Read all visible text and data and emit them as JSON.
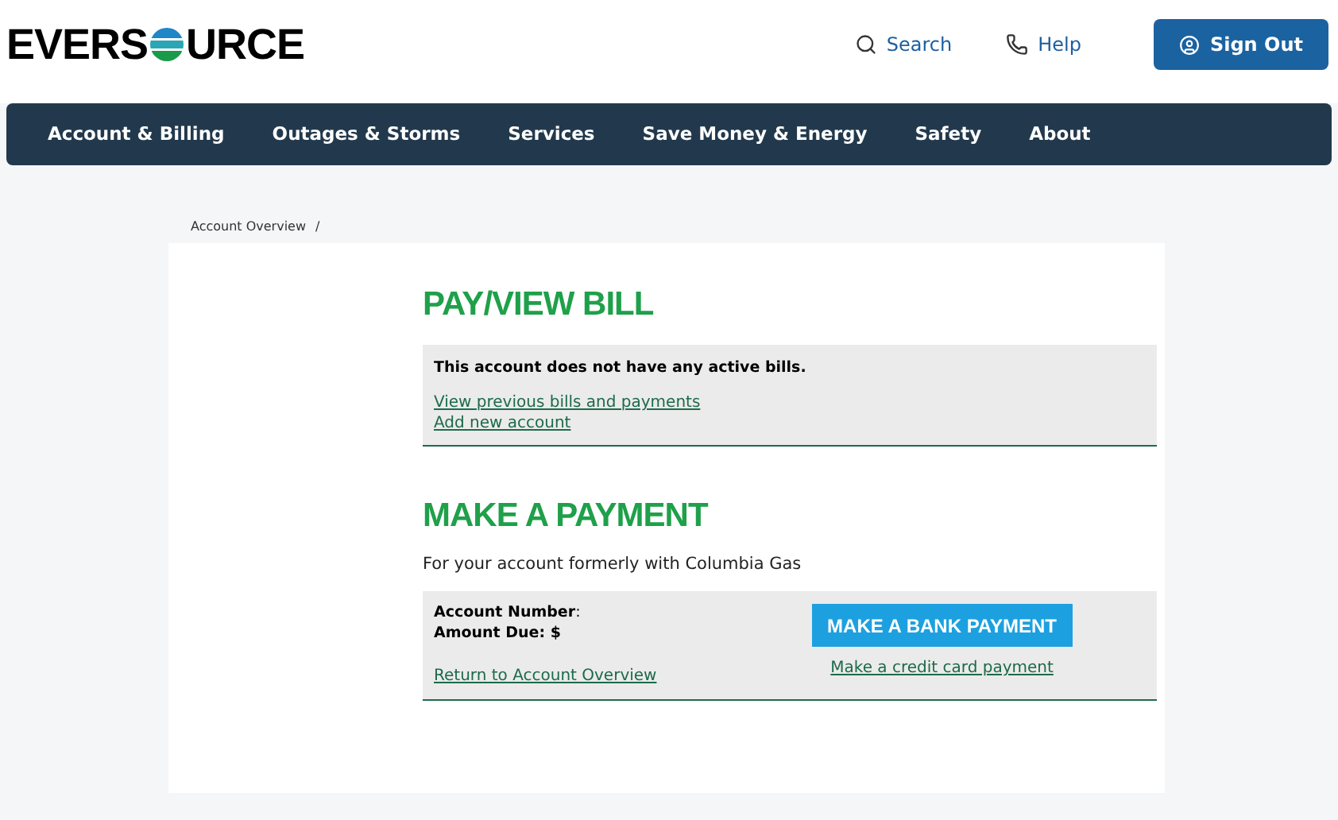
{
  "logo": {
    "before": "EVERS",
    "after": "URCE"
  },
  "header_links": [
    {
      "kind": "search",
      "label": "Search"
    },
    {
      "kind": "help",
      "label": "Help"
    }
  ],
  "sign_out": "Sign Out",
  "nav": [
    "Account & Billing",
    "Outages & Storms",
    "Services",
    "Save Money & Energy",
    "Safety",
    "About"
  ],
  "breadcrumb": [
    "Account Overview"
  ],
  "breadcrumb_separator": "/",
  "pay_view_bill": {
    "title": "PAY/VIEW BILL",
    "message": "This account does not have any active bills.",
    "links": [
      "View previous bills and payments",
      "Add new account"
    ]
  },
  "make_payment": {
    "title": "MAKE A PAYMENT",
    "subtitle": "For your account formerly with Columbia Gas",
    "account_number": "**Account Number**:",
    "amount_due": "Amount Due: $",
    "return_link": "Return to Account Overview",
    "bank_button": "MAKE A BANK PAYMENT",
    "credit_link": "Make a credit card payment"
  }
}
